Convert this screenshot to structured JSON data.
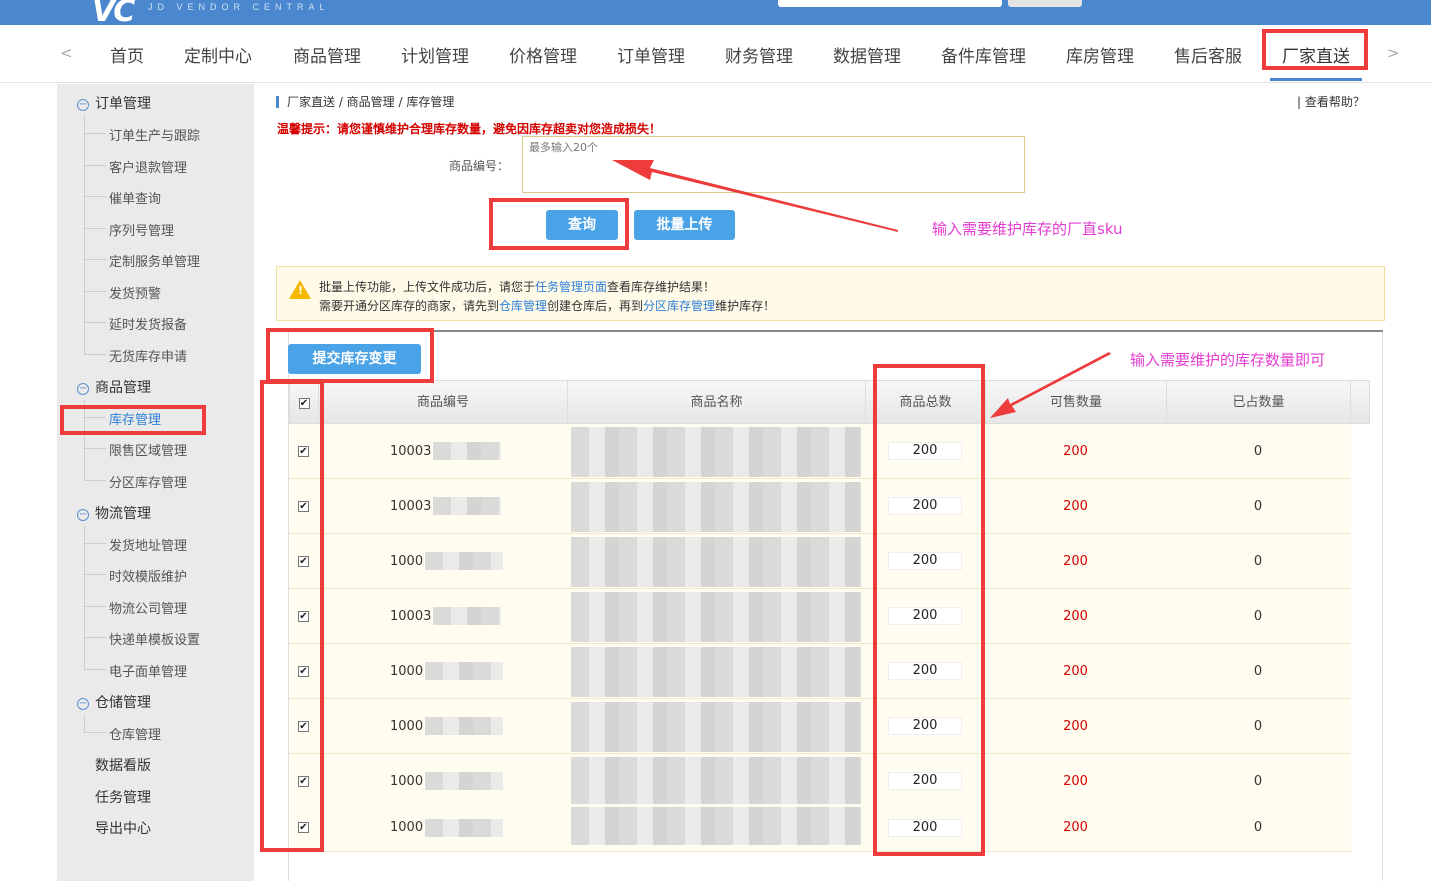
{
  "header": {
    "logo": "VC",
    "logo_sub": "JD VENDOR CENTRAL"
  },
  "nav": {
    "prev_arrow": "<",
    "next_arrow": ">",
    "items": [
      "首页",
      "定制中心",
      "商品管理",
      "计划管理",
      "价格管理",
      "订单管理",
      "财务管理",
      "数据管理",
      "备件库管理",
      "库房管理",
      "售后客服",
      "厂家直送"
    ],
    "active": "厂家直送"
  },
  "sidebar": {
    "groups": [
      {
        "label": "订单管理",
        "icon": "collapse-icon",
        "items": [
          "订单生产与跟踪",
          "客户退款管理",
          "催单查询",
          "序列号管理",
          "定制服务单管理",
          "发货预警",
          "延时发货报备",
          "无货库存申请"
        ]
      },
      {
        "label": "商品管理",
        "icon": "collapse-icon",
        "items": [
          "库存管理",
          "限售区域管理",
          "分区库存管理"
        ],
        "active": "库存管理"
      },
      {
        "label": "物流管理",
        "icon": "collapse-icon",
        "items": [
          "发货地址管理",
          "时效模版维护",
          "物流公司管理",
          "快递单模板设置",
          "电子面单管理"
        ]
      },
      {
        "label": "仓储管理",
        "icon": "collapse-icon",
        "items": [
          "仓库管理"
        ]
      }
    ],
    "plain": [
      "数据看版",
      "任务管理",
      "导出中心"
    ]
  },
  "breadcrumb": "厂家直送 / 商品管理 / 库存管理",
  "help": "| 查看帮助？",
  "warning": "温馨提示：请您谨慎维护合理库存数量，避免因库存超卖对您造成损失！",
  "search": {
    "label": "商品编号：",
    "placeholder": "最多输入20个",
    "query_button": "查询",
    "upload_button": "批量上传"
  },
  "notice": {
    "icon": "warning-icon",
    "line1_a": "批量上传功能，上传文件成功后，请您于",
    "line1_link": "任务管理页面",
    "line1_b": "查看库存维护结果！",
    "line2_a": "需要开通分区库存的商家，请先到",
    "line2_link1": "仓库管理",
    "line2_b": "创建仓库后，再到",
    "line2_link2": "分区库存管理",
    "line2_c": "维护库存！"
  },
  "submit_button": "提交库存变更",
  "table": {
    "headers": [
      "商品编号",
      "商品名称",
      "商品总数",
      "可售数量",
      "已占数量"
    ],
    "rows": [
      {
        "sku": "10003",
        "total": "200",
        "sellable": "200",
        "occupied": "0"
      },
      {
        "sku": "10003",
        "total": "200",
        "sellable": "200",
        "occupied": "0"
      },
      {
        "sku": "1000",
        "total": "200",
        "sellable": "200",
        "occupied": "0"
      },
      {
        "sku": "10003",
        "total": "200",
        "sellable": "200",
        "occupied": "0"
      },
      {
        "sku": "1000",
        "total": "200",
        "sellable": "200",
        "occupied": "0"
      },
      {
        "sku": "1000",
        "total": "200",
        "sellable": "200",
        "occupied": "0"
      },
      {
        "sku": "1000",
        "total": "200",
        "sellable": "200",
        "occupied": "0"
      },
      {
        "sku": "1000",
        "total": "200",
        "sellable": "200",
        "occupied": "0"
      }
    ]
  },
  "annotations": {
    "sku_hint": "输入需要维护库存的厂直sku",
    "qty_hint": "输入需要维护的库存数量即可",
    "highlight_color": "#ee3b3b",
    "hint_color": "#e23dd0"
  },
  "colors": {
    "brand": "#4a87cf",
    "button": "#4aa3e6",
    "warning": "#d40000"
  }
}
